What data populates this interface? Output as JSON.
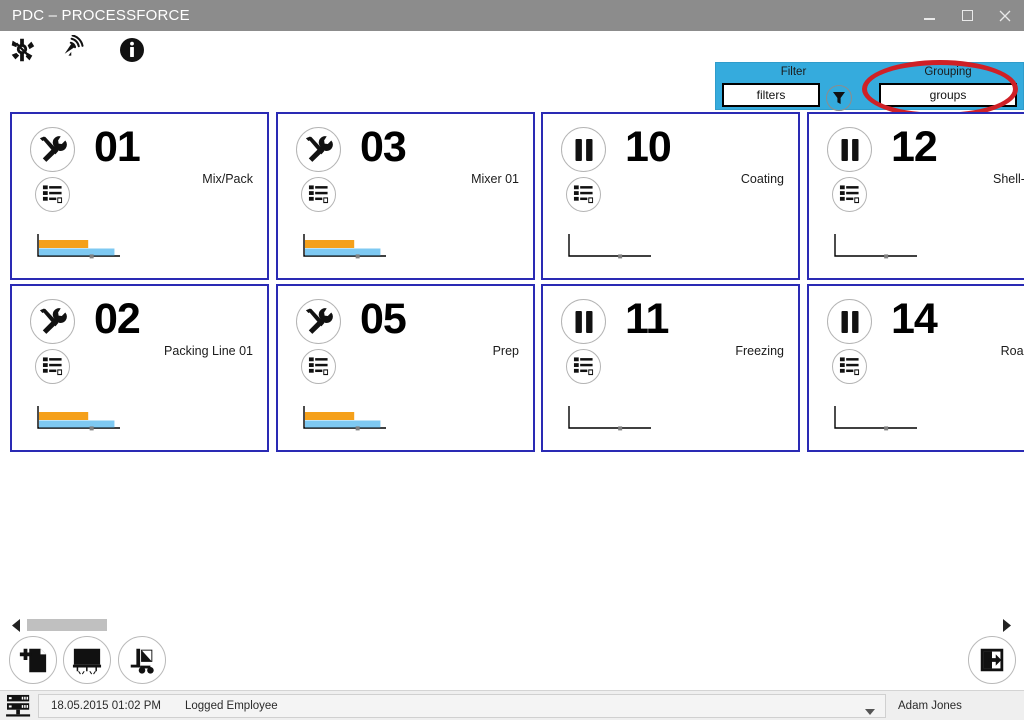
{
  "window": {
    "title": "PDC – PROCESSFORCE",
    "minimize_label": "Minimize",
    "maximize_label": "Maximize",
    "close_label": "Close",
    "titlebar_color": "#8c8c8c"
  },
  "toolbar": {
    "items": [
      {
        "name": "resources-icon",
        "label": "Resources"
      },
      {
        "name": "broadcast-icon",
        "label": "Broadcast"
      },
      {
        "name": "info-icon",
        "label": "Info"
      }
    ]
  },
  "filter_panel": {
    "accent_color": "#35abdd",
    "filter": {
      "label": "Filter",
      "value": "filters"
    },
    "grouping": {
      "label": "Grouping",
      "value": "groups"
    },
    "funnel_button": {
      "name": "funnel-icon",
      "label": "Filter"
    },
    "highlight_color": "#cf2026"
  },
  "cards": [
    {
      "number": "01",
      "name": "Mix/Pack",
      "status": "setup",
      "chart": {
        "orange": 60,
        "blue": 92,
        "marker": 82
      }
    },
    {
      "number": "03",
      "name": "Mixer 01",
      "status": "setup",
      "chart": {
        "orange": 60,
        "blue": 92,
        "marker": 82
      }
    },
    {
      "number": "10",
      "name": "Coating",
      "status": "paused",
      "chart": {
        "orange": 0,
        "blue": 0,
        "marker": 78
      }
    },
    {
      "number": "12",
      "name": "Shell-Peel",
      "status": "paused",
      "chart": {
        "orange": 0,
        "blue": 0,
        "marker": 78
      }
    },
    {
      "number": "02",
      "name": "Packing Line 01",
      "status": "setup",
      "chart": {
        "orange": 60,
        "blue": 92,
        "marker": 82
      }
    },
    {
      "number": "05",
      "name": "Prep",
      "status": "setup",
      "chart": {
        "orange": 60,
        "blue": 92,
        "marker": 82
      }
    },
    {
      "number": "11",
      "name": "Freezing",
      "status": "paused",
      "chart": {
        "orange": 0,
        "blue": 0,
        "marker": 78
      }
    },
    {
      "number": "14",
      "name": "Roasting",
      "status": "paused",
      "chart": {
        "orange": 0,
        "blue": 0,
        "marker": 78
      }
    }
  ],
  "card_chart_colors": {
    "orange": "#f5a01a",
    "blue": "#7ec9f2",
    "axis": "#000000",
    "marker": "#808080"
  },
  "scrollbar": {
    "left_arrow": "◀",
    "right_arrow": "▶",
    "thumb_color": "#c0c0c0"
  },
  "bottom_actions": [
    {
      "name": "new-document-icon",
      "label": "New Document"
    },
    {
      "name": "monitor-board-icon",
      "label": "Monitor"
    },
    {
      "name": "forklift-icon",
      "label": "Material Handling"
    },
    {
      "name": "exit-icon",
      "label": "Exit"
    }
  ],
  "statusbar": {
    "server_icon": "server-icon",
    "datetime": "18.05.2015 01:02 PM",
    "logged_label": "Logged Employee",
    "dropdown_caret": "▼",
    "user": "Adam Jones"
  }
}
